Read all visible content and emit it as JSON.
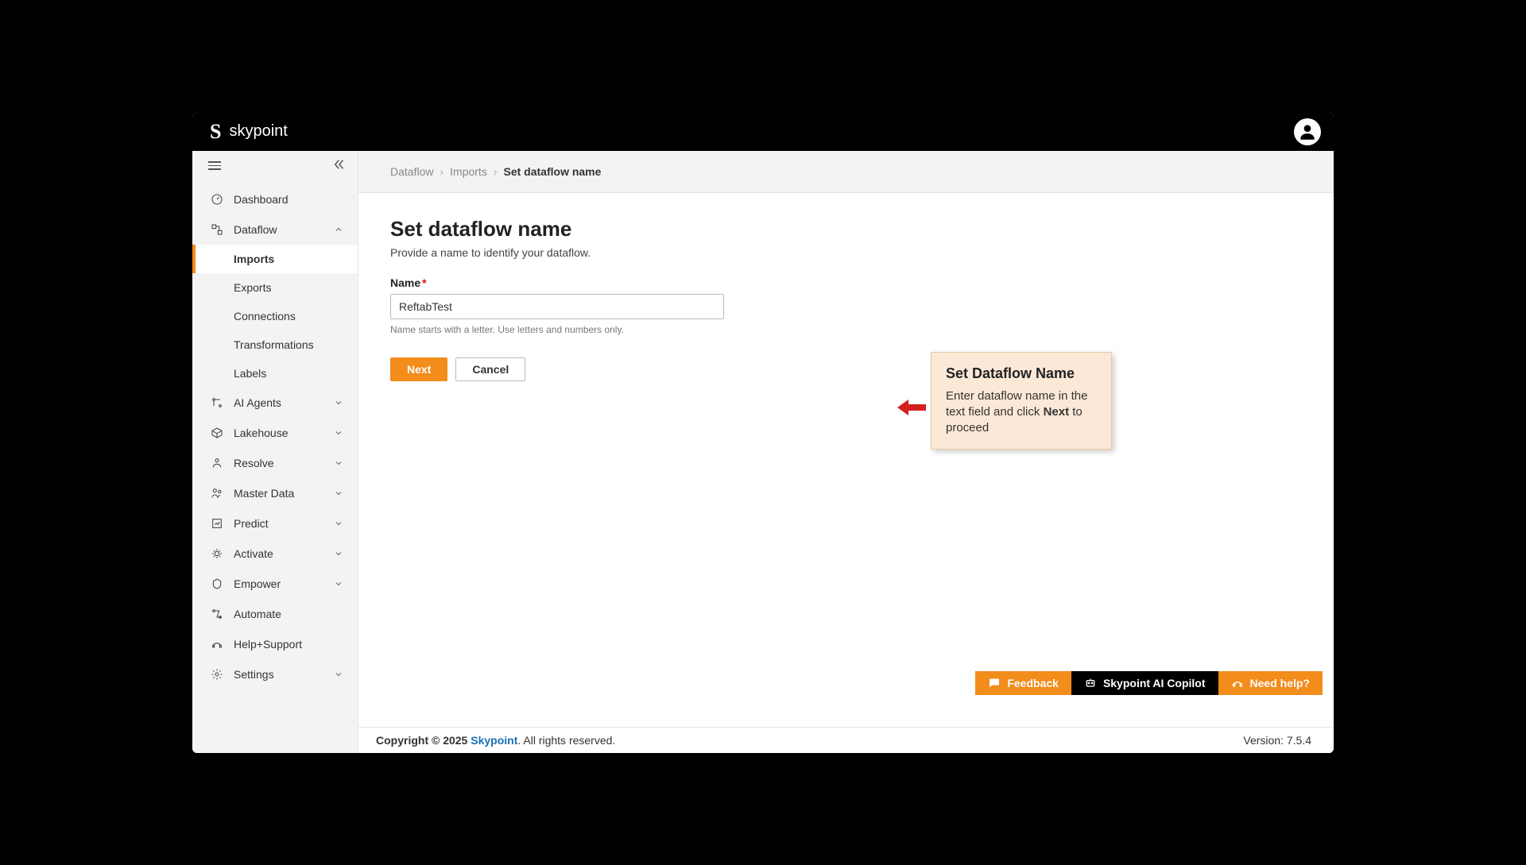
{
  "brand": {
    "name": "skypoint"
  },
  "breadcrumb": {
    "items": [
      "Dataflow",
      "Imports"
    ],
    "current": "Set dataflow name"
  },
  "page": {
    "title": "Set dataflow name",
    "subtitle": "Provide a name to identify your dataflow.",
    "name_label": "Name",
    "name_value": "ReftabTest",
    "name_helper": "Name starts with a letter. Use letters and numbers only.",
    "next_label": "Next",
    "cancel_label": "Cancel"
  },
  "callout": {
    "title": "Set Dataflow Name",
    "text_before": "Enter dataflow name in the text field and click ",
    "bold": "Next",
    "text_after": " to proceed"
  },
  "sidebar": {
    "items": [
      {
        "label": "Dashboard",
        "icon": "dashboard"
      },
      {
        "label": "Dataflow",
        "icon": "dataflow",
        "expanded": true,
        "children": [
          {
            "label": "Imports",
            "active": true
          },
          {
            "label": "Exports"
          },
          {
            "label": "Connections"
          },
          {
            "label": "Transformations"
          },
          {
            "label": "Labels"
          }
        ]
      },
      {
        "label": "AI Agents",
        "icon": "ai",
        "expandable": true
      },
      {
        "label": "Lakehouse",
        "icon": "lakehouse",
        "expandable": true
      },
      {
        "label": "Resolve",
        "icon": "resolve",
        "expandable": true
      },
      {
        "label": "Master Data",
        "icon": "masterdata",
        "expandable": true
      },
      {
        "label": "Predict",
        "icon": "predict",
        "expandable": true
      },
      {
        "label": "Activate",
        "icon": "activate",
        "expandable": true
      },
      {
        "label": "Empower",
        "icon": "empower",
        "expandable": true
      },
      {
        "label": "Automate",
        "icon": "automate"
      },
      {
        "label": "Help+Support",
        "icon": "help"
      },
      {
        "label": "Settings",
        "icon": "settings",
        "expandable": true
      }
    ]
  },
  "bottom_actions": {
    "feedback": "Feedback",
    "copilot": "Skypoint AI Copilot",
    "help": "Need help?"
  },
  "footer": {
    "copyright_prefix": "Copyright © 2025 ",
    "brand": "Skypoint",
    "copyright_suffix": ". All rights reserved.",
    "version": "Version: 7.5.4"
  }
}
